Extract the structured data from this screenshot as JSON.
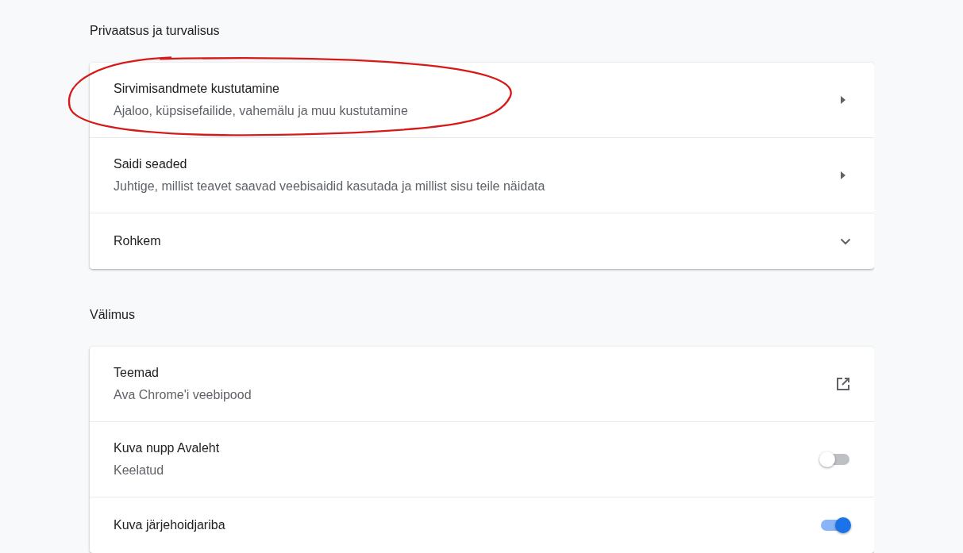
{
  "sections": [
    {
      "title": "Privaatsus ja turvalisus",
      "rows": [
        {
          "kind": "arrow",
          "title": "Sirvimisandmete kustutamine",
          "subtitle": "Ajaloo, küpsisefailide, vahemälu ja muu kustutamine",
          "circled": true
        },
        {
          "kind": "arrow",
          "title": "Saidi seaded",
          "subtitle": "Juhtige, millist teavet saavad veebisaidid kasutada ja millist sisu teile näidata",
          "circled": false
        },
        {
          "kind": "expand",
          "title": "Rohkem",
          "circled": false
        }
      ]
    },
    {
      "title": "Välimus",
      "rows": [
        {
          "kind": "external",
          "title": "Teemad",
          "subtitle": "Ava Chrome'i veebipood",
          "circled": false
        },
        {
          "kind": "toggle",
          "title": "Kuva nupp Avaleht",
          "subtitle": "Keelatud",
          "on": false,
          "circled": false
        },
        {
          "kind": "toggle",
          "title": "Kuva järjehoidjariba",
          "on": true,
          "circled": false
        }
      ]
    }
  ]
}
